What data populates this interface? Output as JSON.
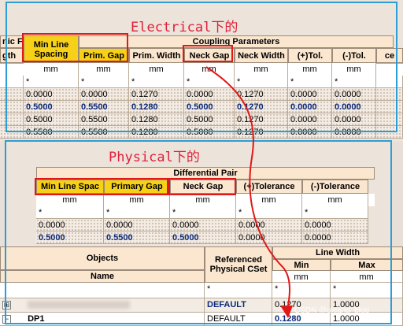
{
  "colors": {
    "annotation_red": "#e01818",
    "annotation_blue": "#2b9ed8",
    "highlight_yellow": "#f7d117",
    "header_bg": "#fbe6cf"
  },
  "annotations": {
    "electrical_title": "Electrical下的",
    "physical_title": "Physical下的",
    "watermark": "CSDN @uxiang_blog"
  },
  "electrical": {
    "partial_left1": "nic F",
    "partial_left2": "gth",
    "group_header": "Coupling Parameters",
    "col_min_line_spacing": "Min Line Spacing",
    "col_prim_gap": "Prim. Gap",
    "col_prim_width": "Prim. Width",
    "col_neck_gap": "Neck Gap",
    "col_neck_width": "Neck Width",
    "col_plus_tol": "(+)Tol.",
    "col_minus_tol": "(-)Tol.",
    "col_partial_right": "ce",
    "unit": "mm",
    "rows": [
      {
        "c1": "*",
        "c2": "*",
        "c3": "*",
        "c4": "*",
        "c5": "*",
        "c6": "*",
        "c7": "*"
      },
      {
        "c1": "0.0000",
        "c2": "0.0000",
        "c3": "0.1270",
        "c4": "0.0000",
        "c5": "0.1270",
        "c6": "0.0000",
        "c7": "0.0000"
      },
      {
        "c1": "0.5000",
        "c2": "0.5500",
        "c3": "0.1280",
        "c4": "0.5000",
        "c5": "0.1270",
        "c6": "0.0000",
        "c7": "0.0000"
      },
      {
        "c1": "0.5000",
        "c2": "0.5500",
        "c3": "0.1280",
        "c4": "0.5000",
        "c5": "0.1270",
        "c6": "0.0000",
        "c7": "0.0000"
      },
      {
        "c1": "0.5500",
        "c2": "0.5500",
        "c3": "0.1280",
        "c4": "0.5000",
        "c5": "0.1270",
        "c6": "0.0000",
        "c7": "0.0000"
      }
    ]
  },
  "physical": {
    "group_header": "Differential Pair",
    "col_min_line_spacing": "Min Line Spac",
    "col_primary_gap": "Primary Gap",
    "col_neck_gap": "Neck Gap",
    "col_plus_tol": "(+)Tolerance",
    "col_minus_tol": "(-)Tolerance",
    "unit": "mm",
    "rows": [
      {
        "c1": "*",
        "c2": "*",
        "c3": "*",
        "c4": "*",
        "c5": "*"
      },
      {
        "c1": "0.0000",
        "c2": "0.0000",
        "c3": "0.0000",
        "c4": "0.0000",
        "c5": "0.0000"
      },
      {
        "c1": "0.5000",
        "c2": "0.5500",
        "c3": "0.5000",
        "c4": "0.0000",
        "c5": "0.0000"
      }
    ]
  },
  "objects": {
    "col_objects": "Objects",
    "col_name": "Name",
    "col_ref_cset": "Referenced Physical CSet",
    "col_line_width": "Line Width",
    "col_min": "Min",
    "col_max": "Max",
    "unit": "mm",
    "rows": [
      {
        "name": "",
        "cset": "*",
        "min": "*",
        "max": "*"
      },
      {
        "name": "",
        "cset": "DEFAULT",
        "min": "0.1270",
        "max": "1.0000"
      },
      {
        "name": "DP1",
        "cset": "DEFAULT",
        "min": "0.1280",
        "max": "1.0000"
      }
    ]
  }
}
